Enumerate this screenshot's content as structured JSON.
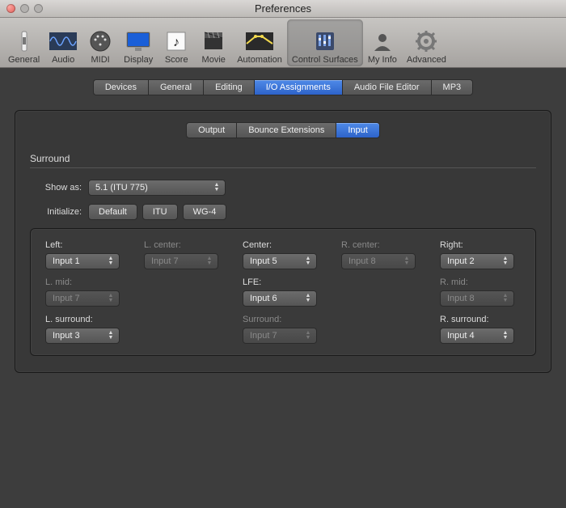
{
  "window": {
    "title": "Preferences"
  },
  "toolbar": [
    {
      "id": "general",
      "label": "General"
    },
    {
      "id": "audio",
      "label": "Audio"
    },
    {
      "id": "midi",
      "label": "MIDI"
    },
    {
      "id": "display",
      "label": "Display"
    },
    {
      "id": "score",
      "label": "Score"
    },
    {
      "id": "movie",
      "label": "Movie"
    },
    {
      "id": "automation",
      "label": "Automation"
    },
    {
      "id": "control-surfaces",
      "label": "Control Surfaces"
    },
    {
      "id": "my-info",
      "label": "My Info"
    },
    {
      "id": "advanced",
      "label": "Advanced"
    }
  ],
  "tabs_primary": [
    {
      "label": "Devices"
    },
    {
      "label": "General"
    },
    {
      "label": "Editing"
    },
    {
      "label": "I/O Assignments",
      "active": true
    },
    {
      "label": "Audio File Editor"
    },
    {
      "label": "MP3"
    }
  ],
  "tabs_secondary": [
    {
      "label": "Output"
    },
    {
      "label": "Bounce Extensions"
    },
    {
      "label": "Input",
      "active": true
    }
  ],
  "surround": {
    "heading": "Surround",
    "show_as_label": "Show as:",
    "show_as_value": "5.1 (ITU 775)",
    "initialize_label": "Initialize:",
    "init_buttons": [
      {
        "id": "default",
        "label": "Default"
      },
      {
        "id": "itu",
        "label": "ITU"
      },
      {
        "id": "wg4",
        "label": "WG-4"
      }
    ],
    "channels": [
      {
        "label": "Left:",
        "value": "Input 1",
        "enabled": true
      },
      {
        "label": "L. center:",
        "value": "Input 7",
        "enabled": false
      },
      {
        "label": "Center:",
        "value": "Input 5",
        "enabled": true
      },
      {
        "label": "R. center:",
        "value": "Input 8",
        "enabled": false
      },
      {
        "label": "Right:",
        "value": "Input 2",
        "enabled": true
      },
      {
        "label": "L. mid:",
        "value": "Input 7",
        "enabled": false
      },
      {
        "label": "",
        "value": "",
        "enabled": null,
        "blank": true
      },
      {
        "label": "LFE:",
        "value": "Input 6",
        "enabled": true
      },
      {
        "label": "",
        "value": "",
        "enabled": null,
        "blank": true
      },
      {
        "label": "R. mid:",
        "value": "Input 8",
        "enabled": false
      },
      {
        "label": "L. surround:",
        "value": "Input 3",
        "enabled": true
      },
      {
        "label": "",
        "value": "",
        "enabled": null,
        "blank": true
      },
      {
        "label": "Surround:",
        "value": "Input 7",
        "enabled": false
      },
      {
        "label": "",
        "value": "",
        "enabled": null,
        "blank": true
      },
      {
        "label": "R. surround:",
        "value": "Input 4",
        "enabled": true
      }
    ]
  }
}
